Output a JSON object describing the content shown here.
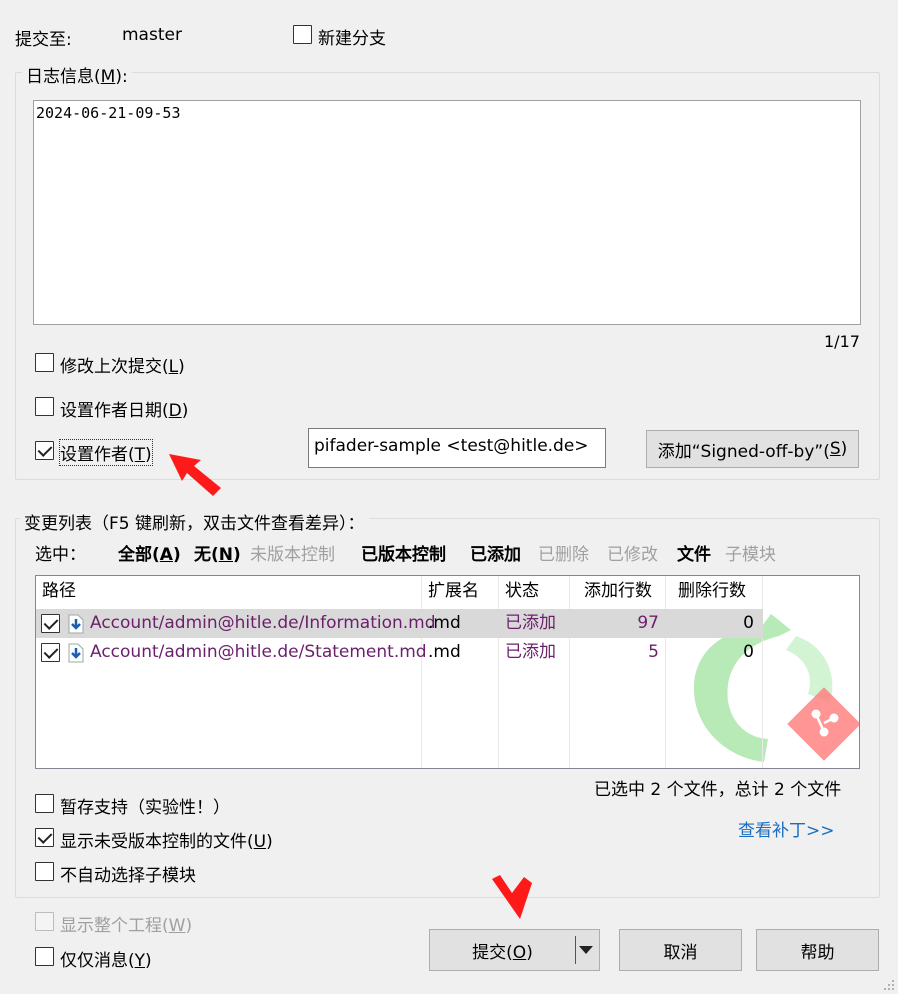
{
  "header": {
    "commit_to_label": "提交至:",
    "branch": "master",
    "new_branch_label": "新建分支"
  },
  "log_group": {
    "title_prefix": "日志信息(",
    "title_key": "M",
    "title_suffix": "):",
    "message": "2024-06-21-09-53",
    "counter": "1/17"
  },
  "options": {
    "amend_prefix": "修改上次提交(",
    "amend_key": "L",
    "set_date_prefix": "设置作者日期(",
    "set_date_key": "D",
    "set_author_prefix": "设置作者(",
    "set_author_key": "T",
    "author_value": "pifader-sample <test@hitle.de>",
    "signoff_prefix": "添加“Signed-off-by”(",
    "signoff_key": "S",
    "paren_close": ")"
  },
  "changes": {
    "title": "变更列表（F5 键刷新，双击文件查看差异）：",
    "select_label": "选中：",
    "filters": [
      {
        "prefix": "全部(",
        "key": "A",
        "suffix": ")"
      },
      {
        "prefix": "无(",
        "key": "N",
        "suffix": ")"
      },
      {
        "label": "未版本控制"
      },
      {
        "label": "已版本控制"
      },
      {
        "label": "已添加"
      },
      {
        "label": "已删除"
      },
      {
        "label": "已修改"
      },
      {
        "label": "文件"
      },
      {
        "label": "子模块"
      }
    ],
    "columns": [
      "路径",
      "扩展名",
      "状态",
      "添加行数",
      "删除行数"
    ],
    "rows": [
      {
        "path": "Account/admin@hitle.de/Information.md",
        "ext": ".md",
        "status": "已添加",
        "added": "97",
        "deleted": "0"
      },
      {
        "path": "Account/admin@hitle.de/Statement.md",
        "ext": ".md",
        "status": "已添加",
        "added": "5",
        "deleted": "0"
      }
    ],
    "summary": "已选中 2 个文件，总计 2 个文件",
    "stash_label": "暂存支持（实验性！）",
    "show_unversioned_prefix": "显示未受版本控制的文件(",
    "show_unversioned_key": "U",
    "no_auto_submodule_label": "不自动选择子模块",
    "view_patch": "查看补丁>>"
  },
  "bottom": {
    "show_project_prefix": "显示整个工程(",
    "show_project_key": "W",
    "message_only_prefix": "仅仅消息(",
    "message_only_key": "Y",
    "commit_prefix": "提交(",
    "commit_key": "O",
    "cancel": "取消",
    "help": "帮助"
  },
  "colors": {
    "annotation_arrow": "#ff1a1a",
    "link": "#1a6ec2",
    "added_text": "#6b1f6b"
  }
}
